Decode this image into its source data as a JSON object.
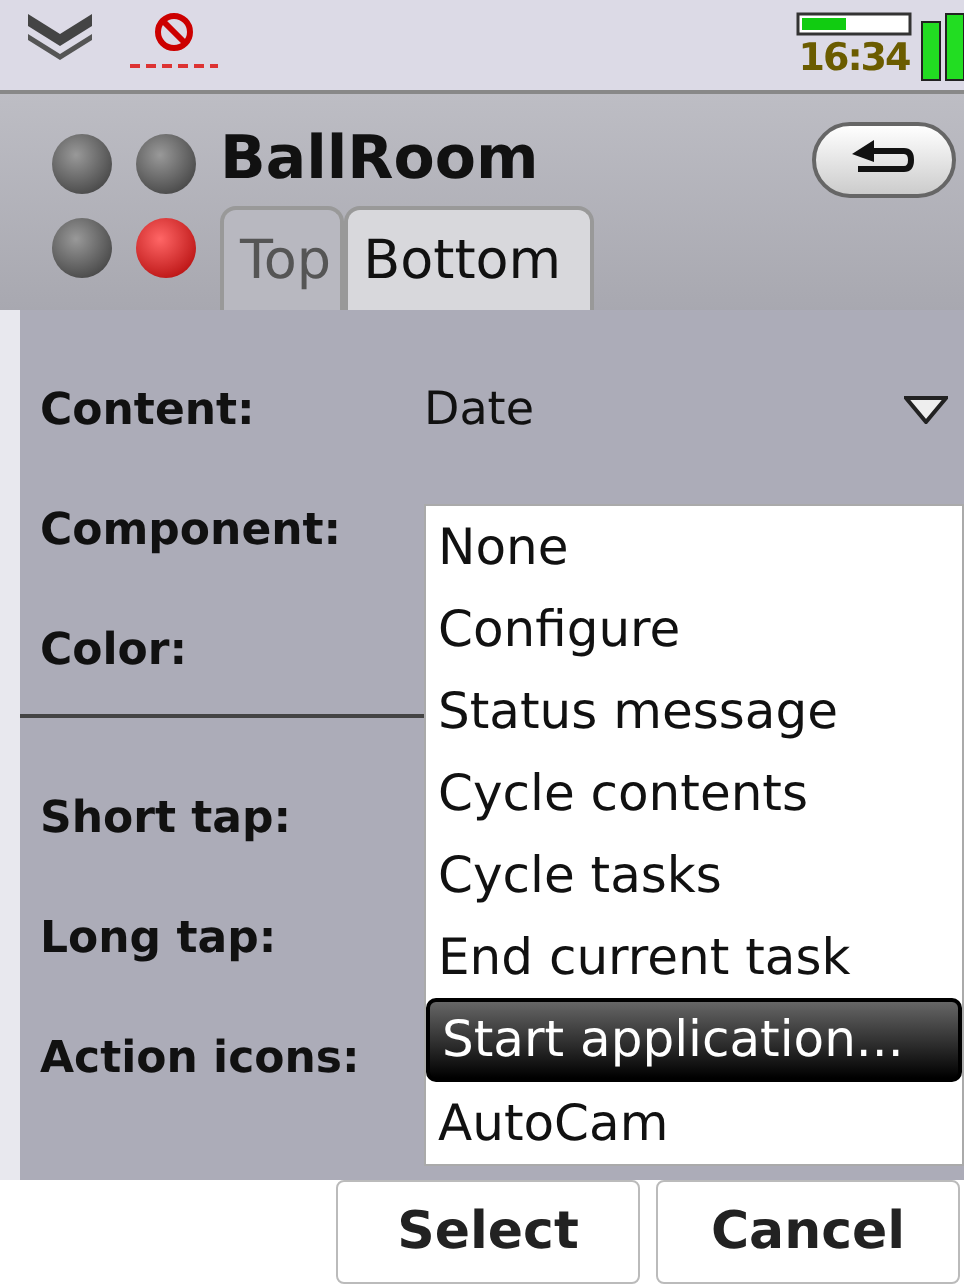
{
  "status_bar": {
    "time": "16:34"
  },
  "header": {
    "title": "BallRoom",
    "lights": [
      {
        "on": false
      },
      {
        "on": false
      },
      {
        "on": false
      },
      {
        "on": true
      }
    ],
    "tabs": [
      {
        "label": "Top",
        "selected": false
      },
      {
        "label": "Bottom",
        "selected": true
      }
    ]
  },
  "settings": [
    {
      "label": "Content:",
      "value": "Date"
    },
    {
      "label": "Component:"
    },
    {
      "label": "Color:"
    }
  ],
  "actions": [
    {
      "label": "Short tap:"
    },
    {
      "label": "Long tap:"
    },
    {
      "label": "Action icons:"
    }
  ],
  "menu": [
    {
      "label": "None",
      "selected": false
    },
    {
      "label": "Configure",
      "selected": false
    },
    {
      "label": "Status message",
      "selected": false
    },
    {
      "label": "Cycle contents",
      "selected": false
    },
    {
      "label": "Cycle tasks",
      "selected": false
    },
    {
      "label": "End current task",
      "selected": false
    },
    {
      "label": "Start application...",
      "selected": true
    },
    {
      "label": "AutoCam",
      "selected": false
    }
  ],
  "buttons": [
    "Select",
    "Cancel"
  ]
}
